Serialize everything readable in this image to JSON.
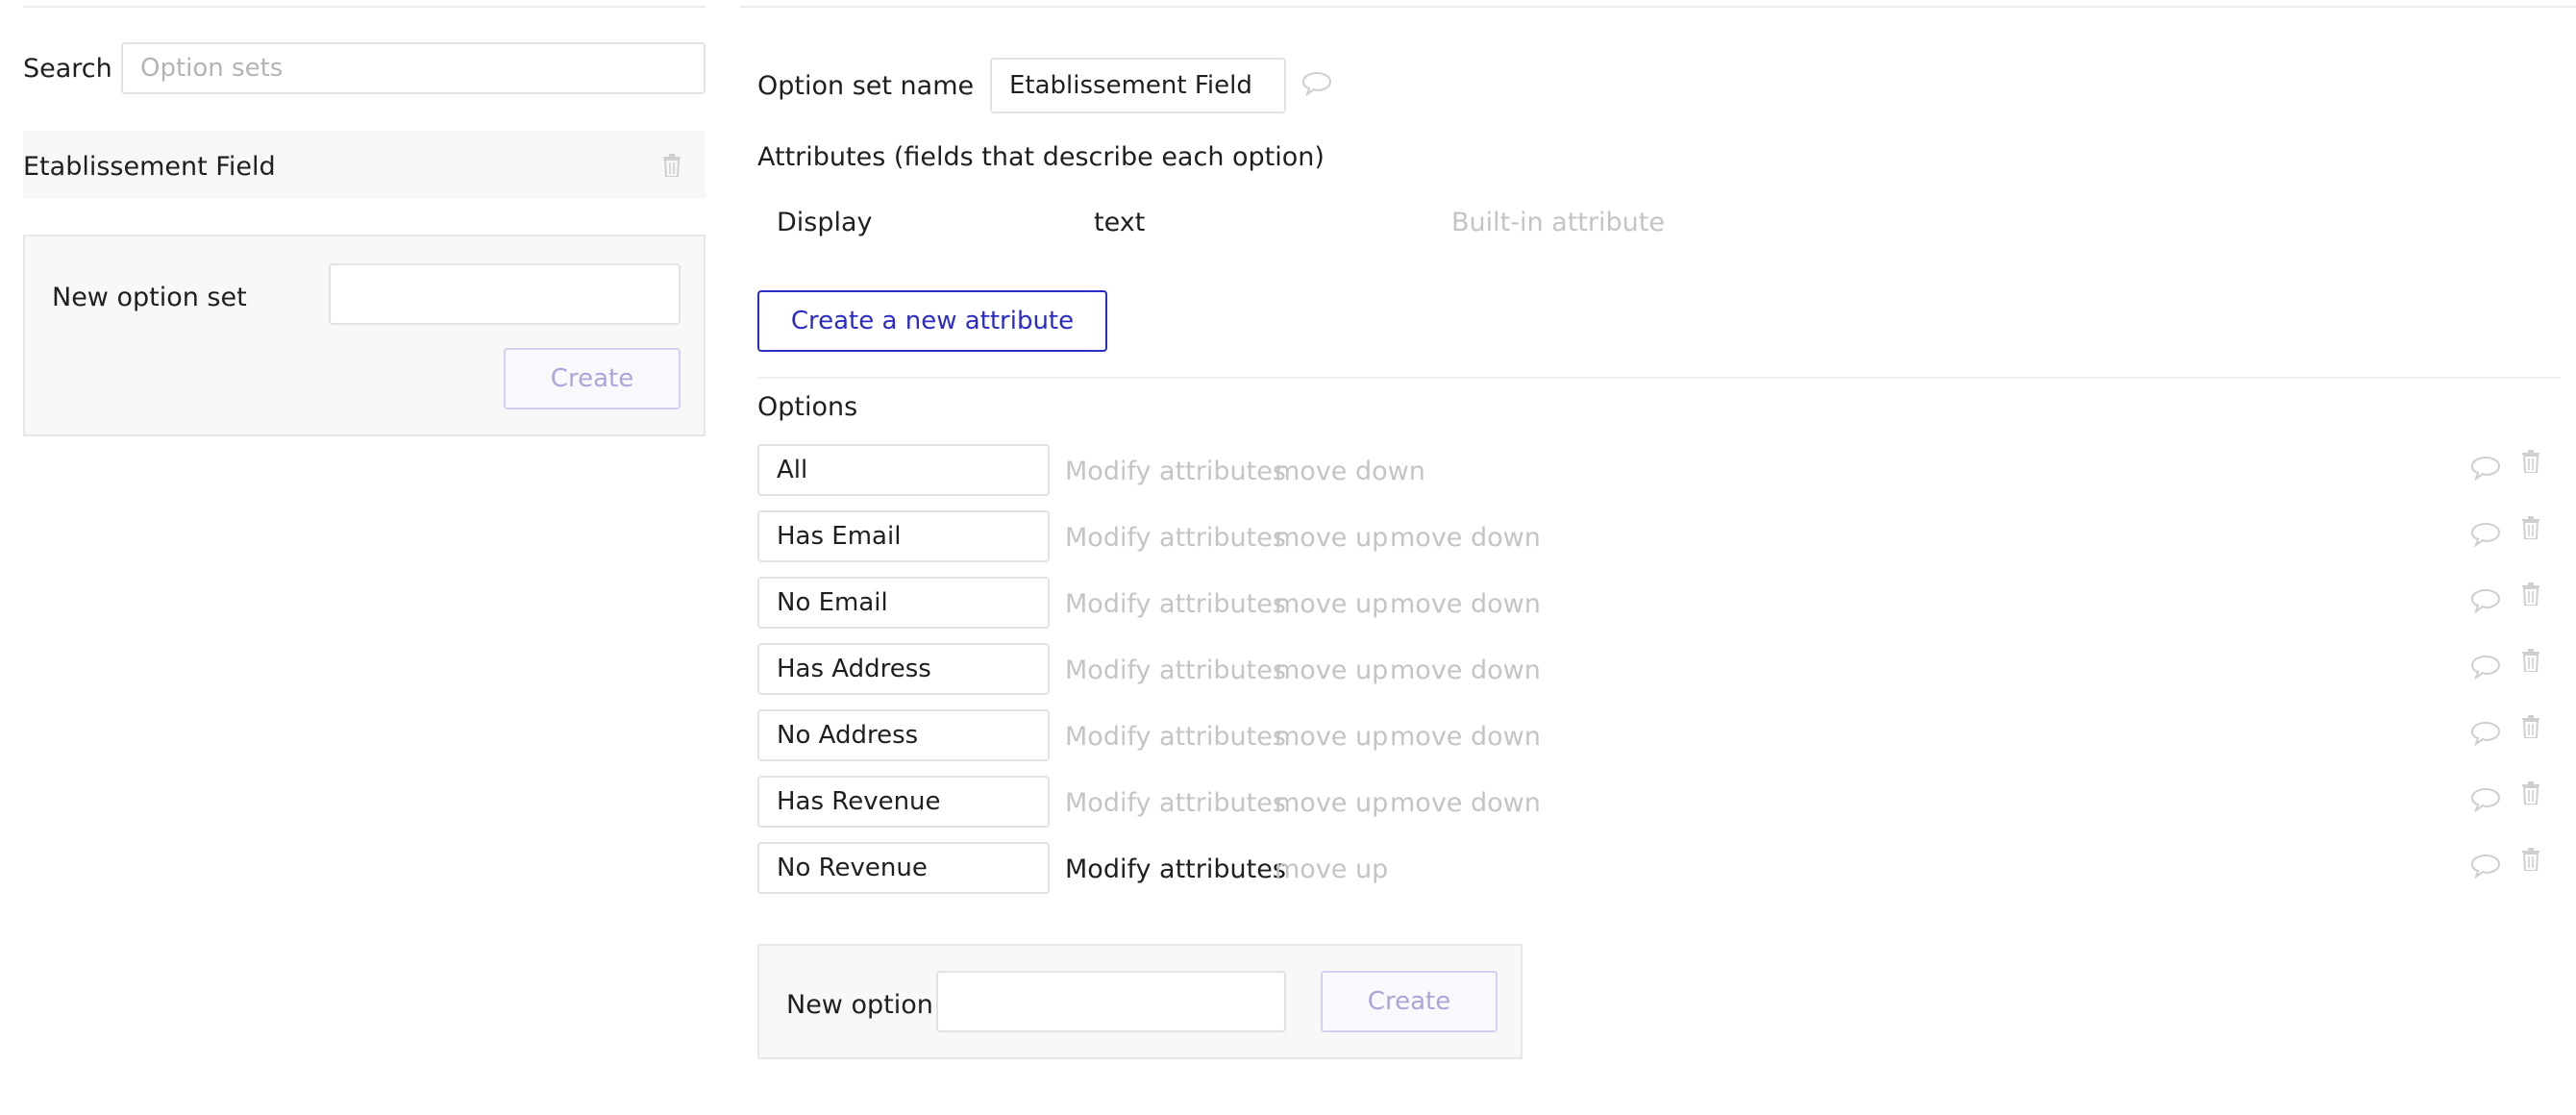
{
  "left_panel": {
    "search_label": "Search",
    "search_placeholder": "Option sets",
    "option_sets": [
      {
        "name": "Etablissement Field"
      }
    ],
    "new_option_set_label": "New option set",
    "new_option_set_value": "",
    "create_label": "Create"
  },
  "right_panel": {
    "option_set_name_label": "Option set name",
    "option_set_name_value": "Etablissement Field",
    "attributes_heading": "Attributes (fields that describe each option)",
    "attributes": [
      {
        "name": "Display",
        "type": "text",
        "note": "Built-in attribute"
      }
    ],
    "create_attribute_label": "Create a new attribute",
    "options_heading": "Options",
    "modify_label": "Modify attributes",
    "move_up_label": "move up",
    "move_down_label": "move down",
    "options": [
      {
        "value": "All",
        "move_up": false,
        "move_down": true,
        "modify_active": false
      },
      {
        "value": "Has Email",
        "move_up": true,
        "move_down": true,
        "modify_active": false
      },
      {
        "value": "No Email",
        "move_up": true,
        "move_down": true,
        "modify_active": false
      },
      {
        "value": "Has Address",
        "move_up": true,
        "move_down": true,
        "modify_active": false
      },
      {
        "value": "No Address",
        "move_up": true,
        "move_down": true,
        "modify_active": false
      },
      {
        "value": "Has Revenue",
        "move_up": true,
        "move_down": true,
        "modify_active": false
      },
      {
        "value": "No Revenue",
        "move_up": true,
        "move_down": false,
        "modify_active": true
      }
    ],
    "new_option_label": "New option",
    "new_option_value": "",
    "create_label": "Create"
  },
  "icons": {
    "trash": "trash-icon",
    "comment": "comment-icon"
  },
  "colors": {
    "accent": "#2b2bc8",
    "muted_text": "#c4c4c4",
    "panel_bg": "#f8f8f8",
    "disabled_button": "#a9a7d8"
  }
}
